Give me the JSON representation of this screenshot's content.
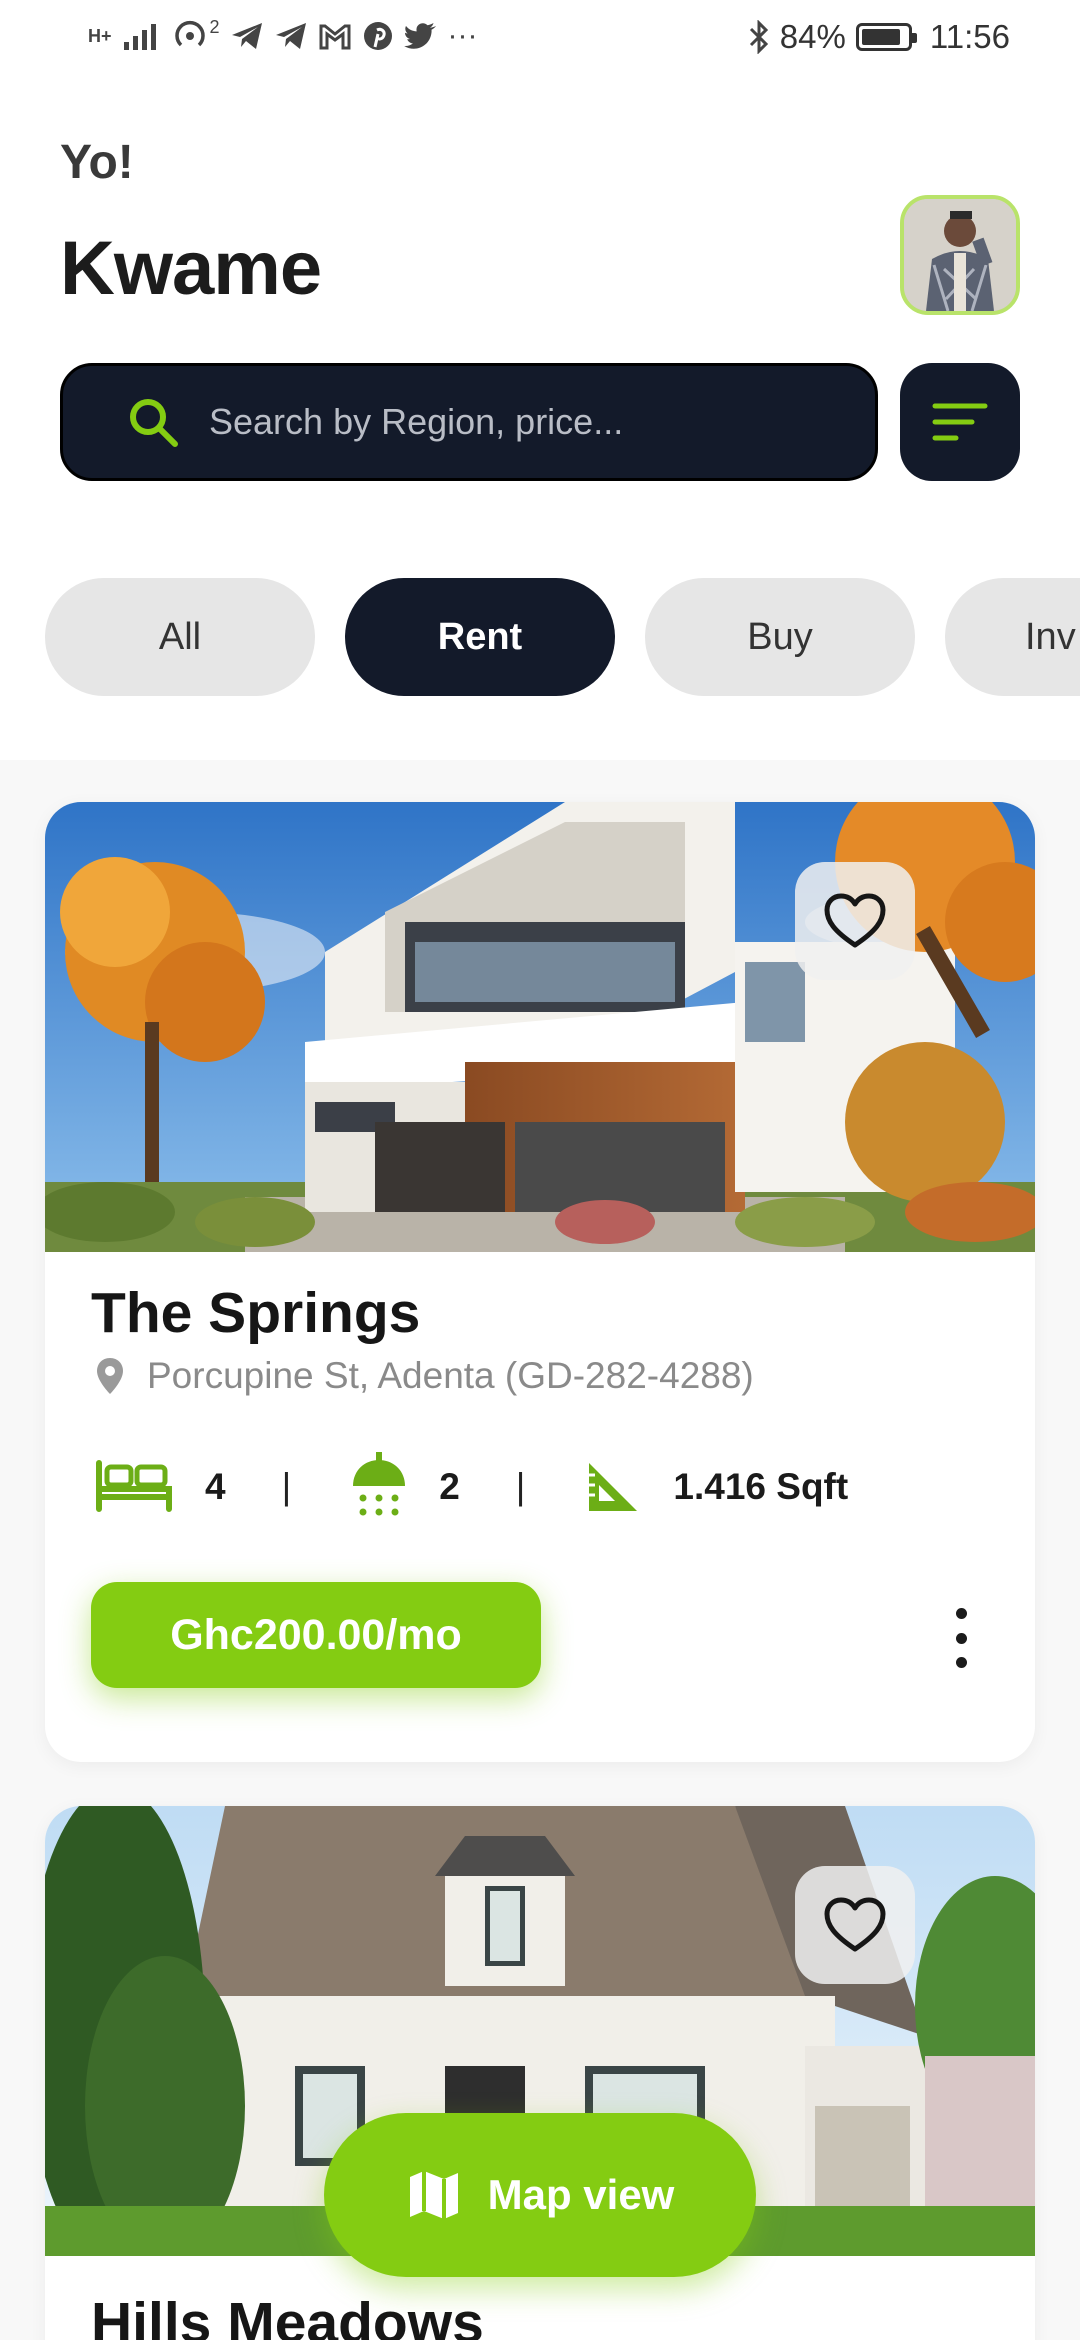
{
  "status_bar": {
    "signal": "H+",
    "sim_index": "2",
    "more": "···",
    "battery_percent": "84%",
    "time": "11:56"
  },
  "header": {
    "greeting": "Yo!",
    "user_name": "Kwame"
  },
  "search": {
    "placeholder": "Search by Region, price..."
  },
  "categories": [
    {
      "label": "All",
      "active": false
    },
    {
      "label": "Rent",
      "active": true
    },
    {
      "label": "Buy",
      "active": false
    },
    {
      "label": "Inv",
      "active": false
    }
  ],
  "listings": [
    {
      "title": "The Springs",
      "location": "Porcupine St, Adenta (GD-282-4288)",
      "bedrooms": "4",
      "bathrooms": "2",
      "area": "1.416 Sqft",
      "price": "Ghc200.00/mo"
    },
    {
      "title": "Hills Meadows"
    }
  ],
  "map_button": {
    "label": "Map view"
  },
  "colors": {
    "accent": "#84cc12",
    "dark": "#131a2a",
    "chip_bg": "#e6e6e6"
  },
  "icons": [
    "search-icon",
    "filter-icon",
    "heart-icon",
    "location-pin-icon",
    "bed-icon",
    "shower-icon",
    "ruler-icon",
    "more-vertical-icon",
    "map-icon",
    "bluetooth-icon",
    "battery-icon"
  ]
}
